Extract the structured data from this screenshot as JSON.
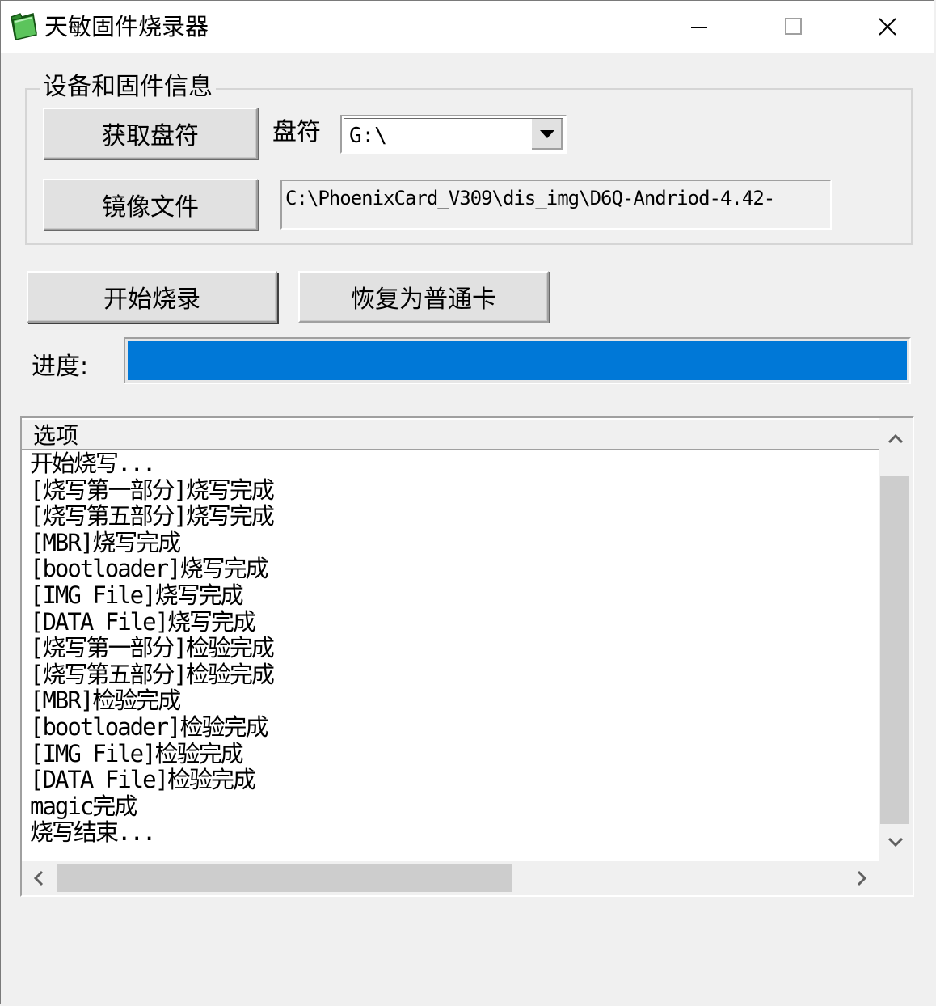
{
  "window": {
    "title": "天敏固件烧录器",
    "controls": {
      "minimize": "minimize",
      "maximize": "maximize",
      "close": "close"
    }
  },
  "device_group": {
    "label": "设备和固件信息",
    "get_drive_button": "获取盘符",
    "drive_label": "盘符",
    "drive_value": "G:\\",
    "image_file_button": "镜像文件",
    "image_path": "C:\\PhoenixCard_V309\\dis_img\\D6Q-Andriod-4.42-"
  },
  "actions": {
    "start_burn_button": "开始烧录",
    "restore_card_button": "恢复为普通卡"
  },
  "progress": {
    "label": "进度:",
    "percent": 100,
    "color": "#0078d7"
  },
  "log": {
    "column_header": "选项",
    "rows": [
      "开始烧写...",
      "[烧写第一部分]烧写完成",
      "[烧写第五部分]烧写完成",
      "[MBR]烧写完成",
      "[bootloader]烧写完成",
      "[IMG File]烧写完成",
      "[DATA File]烧写完成",
      "[烧写第一部分]检验完成",
      "[烧写第五部分]检验完成",
      "[MBR]检验完成",
      "[bootloader]检验完成",
      "[IMG File]检验完成",
      "[DATA File]检验完成",
      "magic完成",
      "烧写结束..."
    ]
  }
}
